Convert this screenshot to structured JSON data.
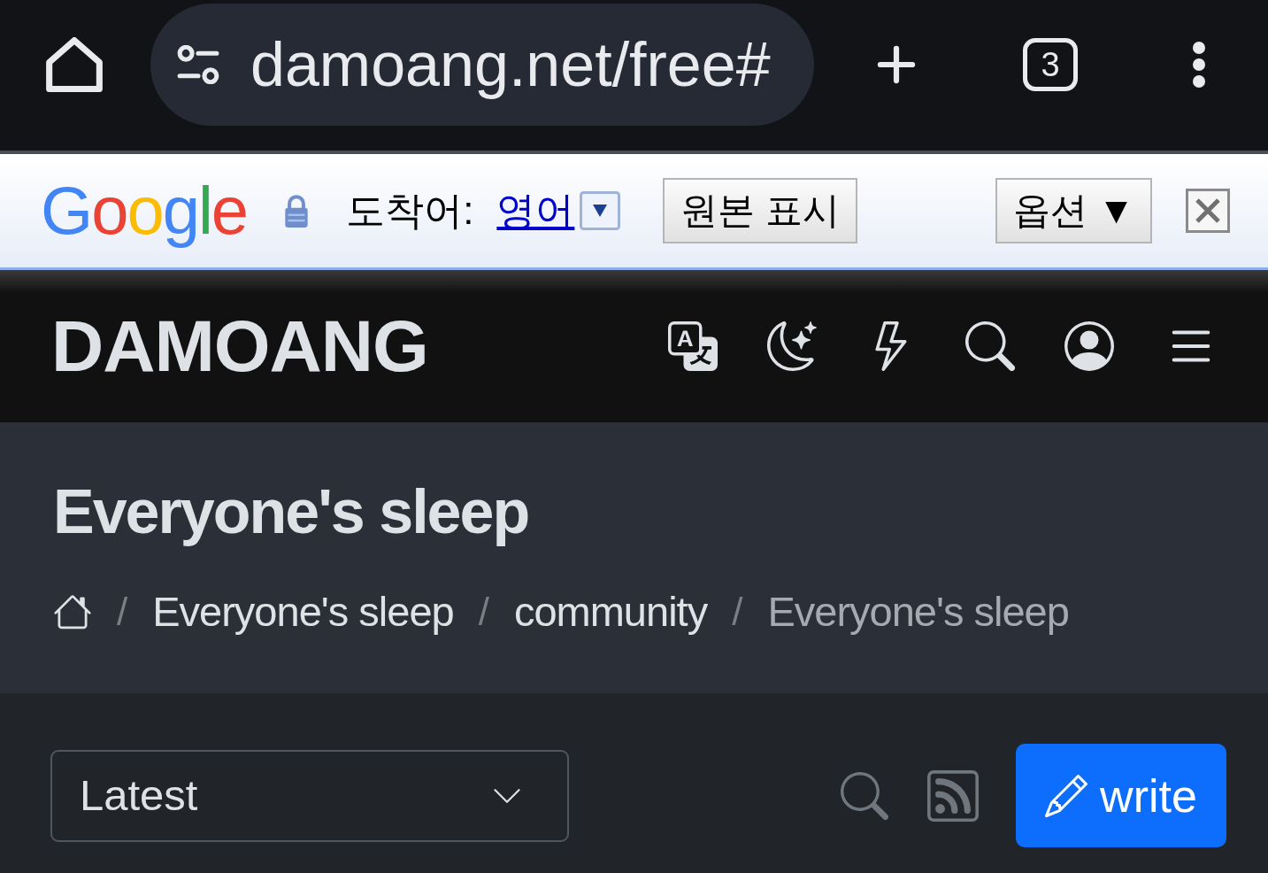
{
  "browser_bar": {
    "url": "damoang.net/free#",
    "tab_count": "3"
  },
  "translate_bar": {
    "logo": "Google",
    "target_label": "도착어:",
    "target_language": "영어",
    "show_original_button": "원본 표시",
    "options_button": "옵션 ▼"
  },
  "site_header": {
    "logo": "DAMOANG"
  },
  "page_header": {
    "title": "Everyone's sleep",
    "breadcrumb": [
      {
        "separator": "/",
        "label": "Everyone's sleep",
        "current": false
      },
      {
        "separator": "/",
        "label": "community",
        "current": false
      },
      {
        "separator": "/",
        "label": "Everyone's sleep",
        "current": true
      }
    ]
  },
  "toolbar": {
    "sort": {
      "value": "Latest"
    },
    "write_button": "write"
  }
}
